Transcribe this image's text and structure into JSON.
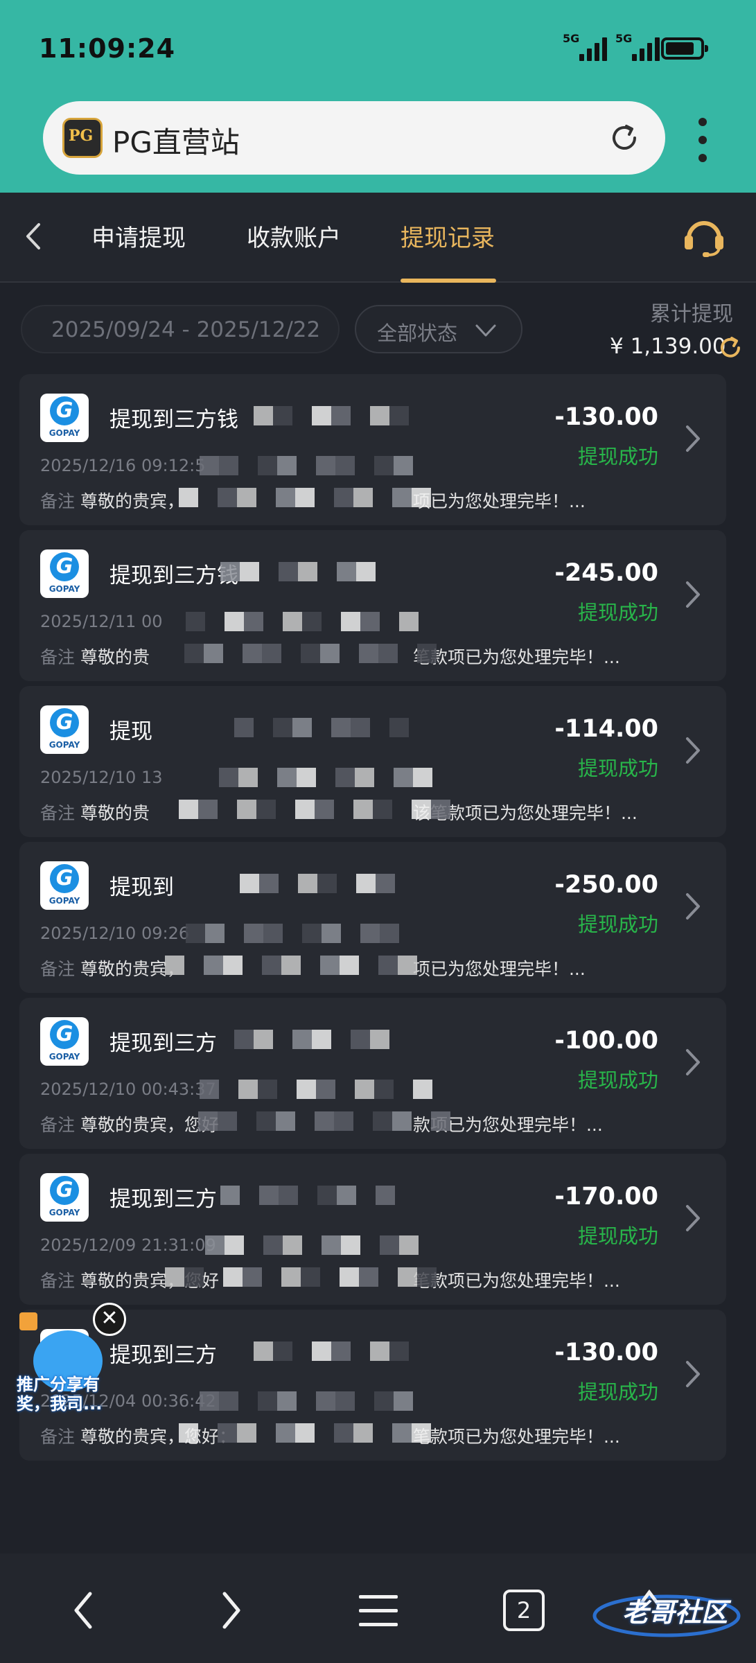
{
  "status_bar": {
    "time": "11:09:24",
    "net1": "5G",
    "net2": "5G"
  },
  "browser": {
    "logo_text": "PG",
    "site_name": "PG直营站"
  },
  "nav": {
    "tabs": [
      {
        "label": "申请提现"
      },
      {
        "label": "收款账户"
      },
      {
        "label": "提现记录",
        "active": true
      }
    ]
  },
  "filter": {
    "date_range": "2025/09/24 - 2025/12/22",
    "status": "全部状态",
    "total_label": "累计提现",
    "total_amount": "¥ 1,139.00"
  },
  "colors": {
    "accent": "#e9b65d",
    "success": "#28b54a",
    "header": "#36b7a4",
    "background": "#1f2229",
    "card": "#272a31"
  },
  "records": [
    {
      "logo": "GOPAY",
      "title": "提现到三方钱",
      "time": "2025/12/16 09:12:5",
      "note_label": "备注",
      "note_start": "尊敬的贵宾，",
      "note_end": "项已为您处理完毕！...",
      "amount": "-130.00",
      "status": "提现成功"
    },
    {
      "logo": "GOPAY",
      "title": "提现到三方钱",
      "time": "2025/12/11 00",
      "note_label": "备注",
      "note_start": "尊敬的贵",
      "note_end": "笔款项已为您处理完毕！...",
      "amount": "-245.00",
      "status": "提现成功"
    },
    {
      "logo": "GOPAY",
      "title": "提现",
      "time": "2025/12/10 13",
      "note_label": "备注",
      "note_start": "尊敬的贵",
      "note_end": "该笔款项已为您处理完毕！...",
      "amount": "-114.00",
      "status": "提现成功"
    },
    {
      "logo": "GOPAY",
      "title": "提现到",
      "time": "2025/12/10 09:26",
      "note_label": "备注",
      "note_start": "尊敬的贵宾，",
      "note_end": "项已为您处理完毕！...",
      "amount": "-250.00",
      "status": "提现成功"
    },
    {
      "logo": "GOPAY",
      "title": "提现到三方",
      "time": "2025/12/10 00:43:37",
      "note_label": "备注",
      "note_start": "尊敬的贵宾，您好",
      "note_end": "款项已为您处理完毕！...",
      "amount": "-100.00",
      "status": "提现成功"
    },
    {
      "logo": "GOPAY",
      "title": "提现到三方",
      "time": "2025/12/09 21:31:09",
      "note_label": "备注",
      "note_start": "尊敬的贵宾，您好",
      "note_end": "笔款项已为您处理完毕！...",
      "amount": "-170.00",
      "status": "提现成功"
    },
    {
      "logo": "GOPAY",
      "title": "提现到三方",
      "time": "2025/12/04 00:36:42",
      "note_label": "备注",
      "note_start": "尊敬的贵宾，您好：",
      "note_end": "笔款项已为您处理完毕！...",
      "amount": "-130.00",
      "status": "提现成功"
    }
  ],
  "promo": {
    "close": "✕",
    "text": "推广分享有奖，我司..."
  },
  "bottom_bar": {
    "tabs_count": "2",
    "watermark": "老哥社区"
  }
}
